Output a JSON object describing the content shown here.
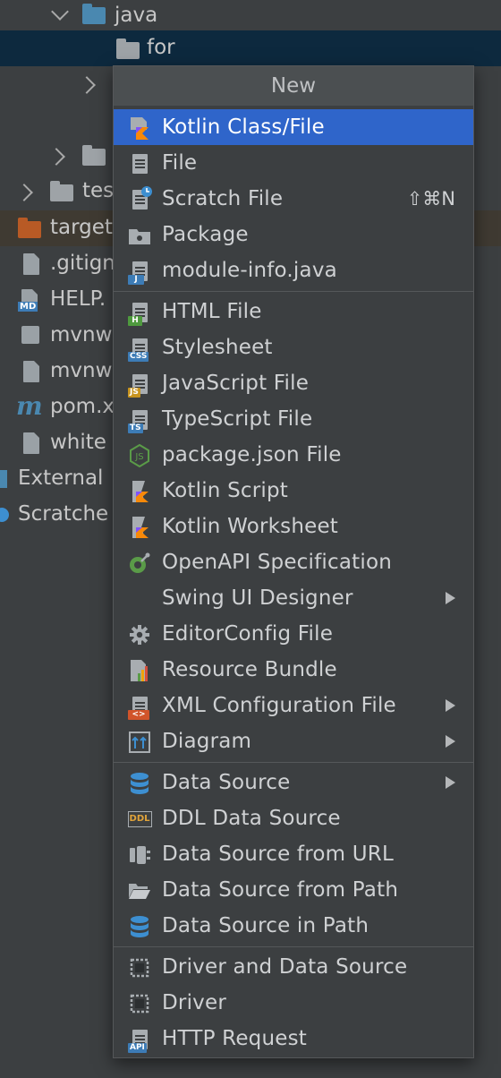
{
  "tree": {
    "rows": [
      {
        "label": "java"
      },
      {
        "label": "for"
      },
      {
        "label": ""
      },
      {
        "label": ""
      },
      {
        "label": "tes"
      },
      {
        "label": "target"
      },
      {
        "label": ".gitign"
      },
      {
        "label": "HELP."
      },
      {
        "label": "mvnw"
      },
      {
        "label": "mvnw"
      },
      {
        "label": "pom.x"
      },
      {
        "label": "white"
      },
      {
        "label": "External"
      },
      {
        "label": "Scratche"
      }
    ]
  },
  "menu": {
    "title": "New",
    "items": [
      {
        "label": "Kotlin Class/File",
        "icon": "kotlin-class-icon"
      },
      {
        "label": "File",
        "icon": "file-icon"
      },
      {
        "label": "Scratch File",
        "icon": "scratch-file-icon",
        "shortcut": "⇧⌘N"
      },
      {
        "label": "Package",
        "icon": "package-icon"
      },
      {
        "label": "module-info.java",
        "icon": "java-module-icon"
      },
      {
        "label": "HTML File",
        "icon": "html-file-icon"
      },
      {
        "label": "Stylesheet",
        "icon": "css-file-icon"
      },
      {
        "label": "JavaScript File",
        "icon": "js-file-icon"
      },
      {
        "label": "TypeScript File",
        "icon": "ts-file-icon"
      },
      {
        "label": "package.json File",
        "icon": "nodejs-icon"
      },
      {
        "label": "Kotlin Script",
        "icon": "kotlin-script-icon"
      },
      {
        "label": "Kotlin Worksheet",
        "icon": "kotlin-worksheet-icon"
      },
      {
        "label": "OpenAPI Specification",
        "icon": "openapi-icon"
      },
      {
        "label": "Swing UI Designer",
        "icon": "none"
      },
      {
        "label": "EditorConfig File",
        "icon": "gear-icon"
      },
      {
        "label": "Resource Bundle",
        "icon": "resource-bundle-icon"
      },
      {
        "label": "XML Configuration File",
        "icon": "xml-file-icon"
      },
      {
        "label": "Diagram",
        "icon": "diagram-icon"
      },
      {
        "label": "Data Source",
        "icon": "database-icon"
      },
      {
        "label": "DDL Data Source",
        "icon": "ddl-icon"
      },
      {
        "label": "Data Source from URL",
        "icon": "plug-icon"
      },
      {
        "label": "Data Source from Path",
        "icon": "folder-open-icon"
      },
      {
        "label": "Data Source in Path",
        "icon": "database-icon"
      },
      {
        "label": "Driver and Data Source",
        "icon": "driver-icon"
      },
      {
        "label": "Driver",
        "icon": "driver-icon"
      },
      {
        "label": "HTTP Request",
        "icon": "api-file-icon"
      }
    ]
  },
  "badges": {
    "html": "H",
    "css": "CSS",
    "js": "JS",
    "ts": "TS",
    "java": "J",
    "xml": "<>",
    "ddl": "DDL",
    "api": "API",
    "md": "MD",
    "maven": "m"
  },
  "colors": {
    "background": "#3c3f41",
    "selection": "#2f65ca",
    "tree_selection": "#0d293e",
    "folder_blue": "#4a88b0",
    "folder_orange": "#b85a25",
    "target_row": "#3f3a32"
  }
}
